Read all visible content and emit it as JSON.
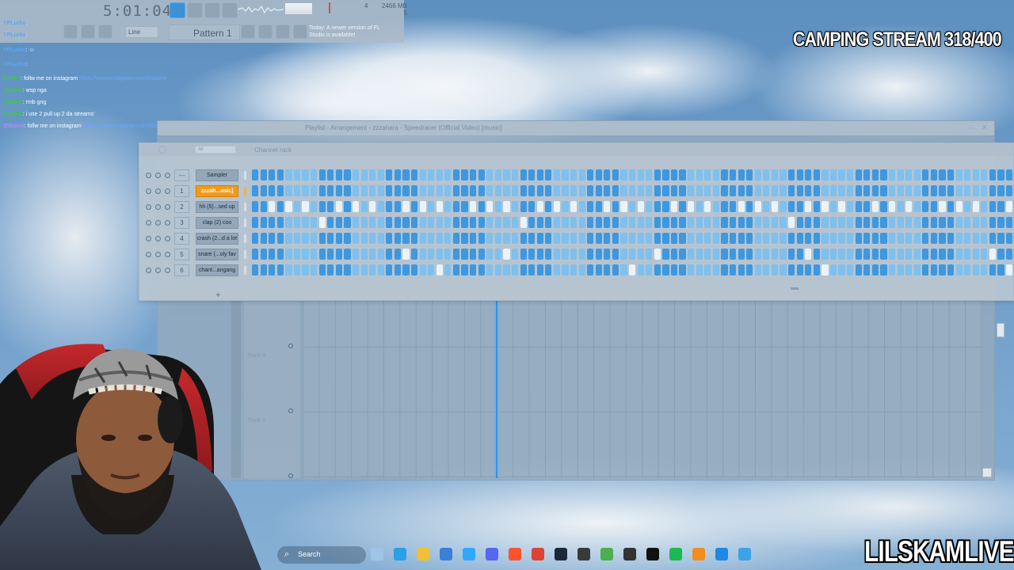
{
  "toolbar": {
    "clock": "5:01:04",
    "pattern": "Pattern 1",
    "snap": "Line",
    "hint": "Today: A newer version of FL Studio is available!",
    "cpu": "4",
    "memory": "2466 MB",
    "voices": "5"
  },
  "chat": [
    {
      "user": "YPLurko",
      "sep": ":",
      "msg": "",
      "link": "",
      "color": "blue"
    },
    {
      "user": "YPLurko",
      "sep": ":",
      "msg": "",
      "link": "",
      "color": "blue"
    },
    {
      "user": "BoiRix",
      "sep": ":",
      "msg": "follw me on instagram",
      "link": "https://www.instagram.com/lilskamx",
      "color": "green"
    },
    {
      "user": "@kikilu",
      "sep": ":",
      "msg": "wsp nga",
      "link": "",
      "color": "green"
    },
    {
      "user": "@kikilu",
      "sep": ":",
      "msg": "rmb gng",
      "link": "",
      "color": "green"
    },
    {
      "user": "@kikilu",
      "sep": ":",
      "msg": "i use 2 pull up 2 da streams'",
      "link": "",
      "color": "green"
    },
    {
      "user": "@Boirix",
      "sep": ":",
      "msg": "follw me on instagram",
      "link": "https://www.instagram.com/lilskamx",
      "color": "purple"
    }
  ],
  "overlay": {
    "stream_title": "CAMPING STREAM 318/400",
    "channel": "LILSKAMLIVE"
  },
  "playlist": {
    "title": "Playlist - Arrangement  ›  zzzahara - Speedracer (Official Video) [music]",
    "tracks": [
      "Track 4",
      "Track 5"
    ]
  },
  "channel_rack": {
    "title": "Channel rack",
    "group": "All",
    "channels": [
      {
        "num": "---",
        "name": "Sampler",
        "selected": false,
        "pattern": "000000000000000000000000000000000000000000000000000000000000000000000000000000000000000000000000"
      },
      {
        "num": "1",
        "name": "zzzah...usic]",
        "selected": true,
        "pattern": "000000000000000000000000000000000000000000000000000000000000000000000000000000000000000000000000"
      },
      {
        "num": "2",
        "name": "hh (5)...sed up",
        "selected": false,
        "pattern": "001010100010101000101010001010100010101000101010001010100010101000101010001010100010101000101010"
      },
      {
        "num": "3",
        "name": "clap (2) coo",
        "selected": false,
        "pattern": "000000001000000000000000000000001000000000000000000000000000000010000000000000000000000000000000"
      },
      {
        "num": "4",
        "name": "crash (2...d a lot",
        "selected": false,
        "pattern": "000000000000000000000000000000000000000000000000000000000000000000000000000000000000000000000000"
      },
      {
        "num": "5",
        "name": "snare (...oly fav",
        "selected": false,
        "pattern": "000000000000000000100000000000100000000000000000100000000000000000100000000000000000000010000000"
      },
      {
        "num": "6",
        "name": "chant...angang",
        "selected": false,
        "pattern": "000000000000000000000010000000000000000000000100000000000000000000001000000000000000000000100000"
      }
    ]
  },
  "taskbar": {
    "search": "Search",
    "apps": [
      "explorer-icon",
      "edge-icon",
      "files-icon",
      "store-icon",
      "photoshop-icon",
      "discord-icon",
      "brave-icon",
      "chrome-icon",
      "steam-icon",
      "keyboard-icon",
      "gamepad-icon",
      "k4-icon",
      "capcut-icon",
      "spotify-icon",
      "fl-studio-icon",
      "azure-icon",
      "notepad-icon"
    ]
  },
  "colors": {
    "step_blue": "#3d98e0",
    "step_on": "#e9f3fa",
    "selected_channel": "#f19a19",
    "playhead": "#2f93ea"
  }
}
